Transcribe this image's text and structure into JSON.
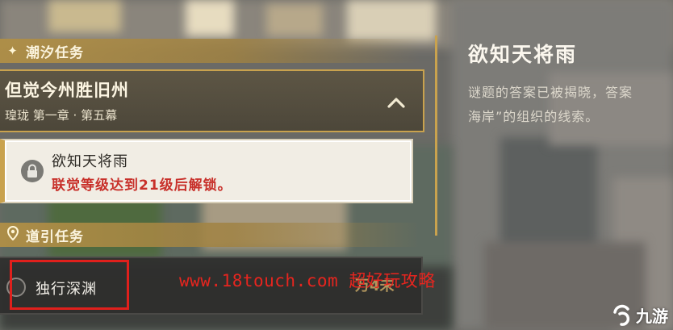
{
  "sections": {
    "tide": {
      "label": "潮汐任务",
      "icon": "sparkle-icon"
    },
    "guide": {
      "label": "道引任务",
      "icon": "location-pin-icon"
    }
  },
  "quest_chapter": {
    "title": "但觉今州胜旧州",
    "subtitle": "瑝珑 第一章 · 第五幕",
    "toggle_icon": "chevron-up-icon"
  },
  "sub_quest": {
    "name": "欲知天将雨",
    "lock_message": "联觉等级达到21级后解锁。",
    "icon": "lock-icon"
  },
  "guide_quest": {
    "name": "独行深渊",
    "right_text": "万4未"
  },
  "detail": {
    "title": "欲知天将雨",
    "description": "谜题的答案已被揭晓，答案\n海岸”的组织的线索。"
  },
  "watermark": {
    "url": "www.18touch.com",
    "text": "超好玩攻略"
  },
  "logo": {
    "text": "九游"
  },
  "colors": {
    "gold": "#c9a24e",
    "lock_red": "#c8302a",
    "highlight_red": "#e0201c"
  }
}
